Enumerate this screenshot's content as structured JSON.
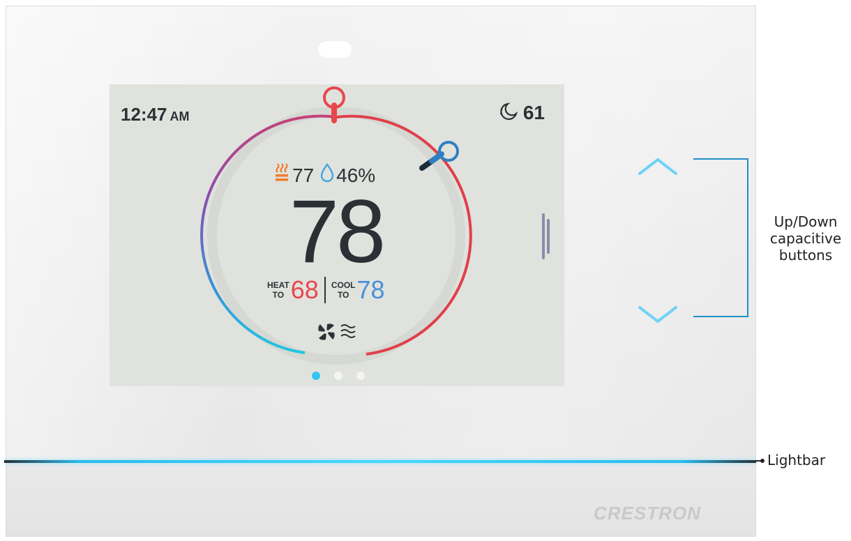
{
  "device": {
    "screen": {
      "time": "12:47",
      "time_suffix": "AM",
      "outdoor": {
        "icon": "moon-icon",
        "temperature": "61"
      },
      "heating_icon": "heat-icon",
      "indoor_temp_small": "77",
      "humidity_icon": "droplet-icon",
      "humidity": "46%",
      "current_temp": "78",
      "heat_label_top": "HEAT",
      "heat_label_bottom": "TO",
      "heat_setpoint": "68",
      "cool_label_top": "COOL",
      "cool_label_bottom": "TO",
      "cool_setpoint": "78",
      "fan_icon": "fan-icon",
      "fan_mode_icon": "fan-speed-icon",
      "pages": 3,
      "active_page": 1
    },
    "brand": "CRESTRON"
  },
  "annotations": {
    "buttons_label": "Up/Down capacitive buttons",
    "lightbar_label": "Lightbar"
  },
  "colors": {
    "heat": "#e8474c",
    "cool": "#4a8fd6",
    "accent": "#35c5f0",
    "humidity": "#3ea7e0",
    "heating_icon": "#f07c2a"
  }
}
